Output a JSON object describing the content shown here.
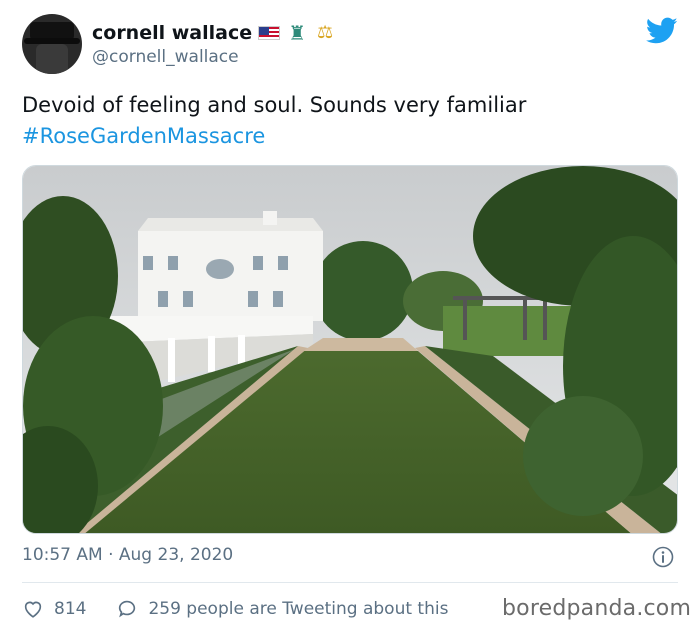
{
  "tweet": {
    "author": {
      "display_name": "cornell wallace",
      "handle": "@cornell_wallace",
      "name_emojis": [
        "us-flag-icon",
        "statue-of-liberty-icon",
        "balance-scale-icon"
      ]
    },
    "text": {
      "body": "Devoid of feeling and soul. Sounds very familiar",
      "hashtag": "#RoseGardenMassacre"
    },
    "media": {
      "subject": "white-house-rose-garden-photo"
    },
    "timestamp": "10:57 AM · Aug 23, 2020",
    "actions": {
      "likes": "814",
      "tweeting": "259 people are Tweeting about this"
    }
  },
  "watermark": "boredpanda.com",
  "colors": {
    "accent": "#1b95e0",
    "muted": "#5b7083",
    "twitter_blue": "#1da1f2"
  }
}
